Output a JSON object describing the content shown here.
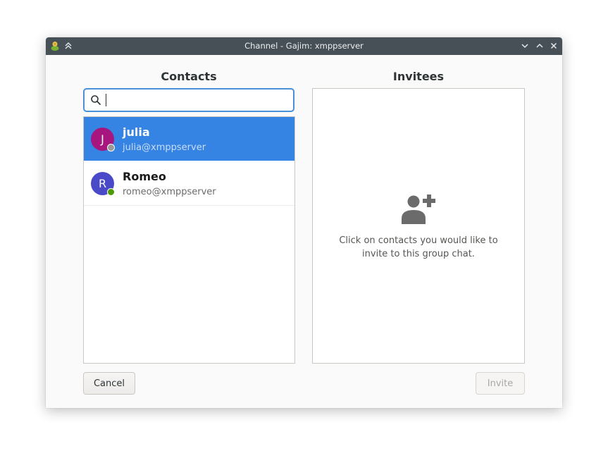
{
  "window": {
    "title": "Channel - Gajim: xmppserver",
    "app_icon": "gajim-icon",
    "buttons": [
      "chevron-double-up-icon",
      "minimize-icon",
      "maximize-icon",
      "close-icon"
    ]
  },
  "contacts": {
    "title": "Contacts",
    "search": {
      "value": "",
      "placeholder": "",
      "icon": "search-icon"
    },
    "items": [
      {
        "initial": "J",
        "name": "julia",
        "jid": "julia@xmppserver",
        "avatar_color": "#a7157e",
        "status_color": "#9a9996",
        "selected": true
      },
      {
        "initial": "R",
        "name": "Romeo",
        "jid": "romeo@xmppserver",
        "avatar_color": "#4a4ac9",
        "status_color": "#4e9a06",
        "selected": false
      }
    ]
  },
  "invitees": {
    "title": "Invitees",
    "placeholder_icon": "add-user-icon",
    "placeholder_text": "Click on contacts you would like to invite to this group chat."
  },
  "actions": {
    "cancel_label": "Cancel",
    "invite_label": "Invite",
    "invite_enabled": false
  },
  "colors": {
    "titlebar": "#475057",
    "selection": "#3584e4",
    "focus_border": "#4a90d9"
  }
}
